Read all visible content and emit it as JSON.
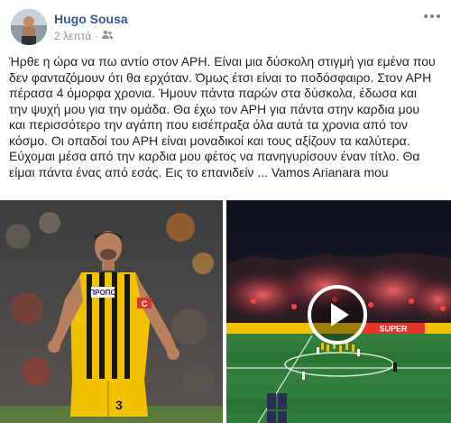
{
  "post": {
    "author": "Hugo Sousa",
    "time": "2 λεπτά",
    "privacy_icon": "friends-icon",
    "text_lines": [
      "Ήρθε η ώρα να πω αντίο στον ΑΡΗ. Είναι μια δύσκολη στιγμή για εμένα που",
      "δεν φανταζόμουν ότι θα ερχόταν. Όμως έτσι είναι το ποδόσφαιρο. Στον ΑΡΗ",
      "πέρασα 4 όμορφα χρονια. Ήμουν πάντα παρών στα δύσκολα, έδωσα και",
      "την ψυχή μου για την ομάδα. Θα έχω τον ΑΡΗ για πάντα στην καρδια μου",
      "και περισσότερο την αγάπη που εισέπραξα όλα αυτά τα χρονια από τον",
      "κόσμο. Οι οπαδοί του ΑΡΗ είναι μοναδικοί και τους αξίζουν τα καλύτερα.",
      "Εύχομαι μέσα από την καρδια μου φέτος να πανηγυρίσουν έναν τίτλο. Θα",
      "είμαι πάντα ένας από εσάς. Εις το επανιδείν ... Vamos Arianara mou"
    ]
  },
  "media": {
    "photo": {
      "shirt_sponsor": "ΠΡΟΠΟ",
      "shirt_number": "3",
      "captain_band": "C"
    },
    "video": {
      "stadium_banner": "SUPER",
      "play_icon": "play-icon"
    }
  },
  "colors": {
    "author_link": "#365899",
    "meta_gray": "#90949c",
    "body_text": "#1d2129",
    "shirt_yellow": "#f2c200"
  }
}
